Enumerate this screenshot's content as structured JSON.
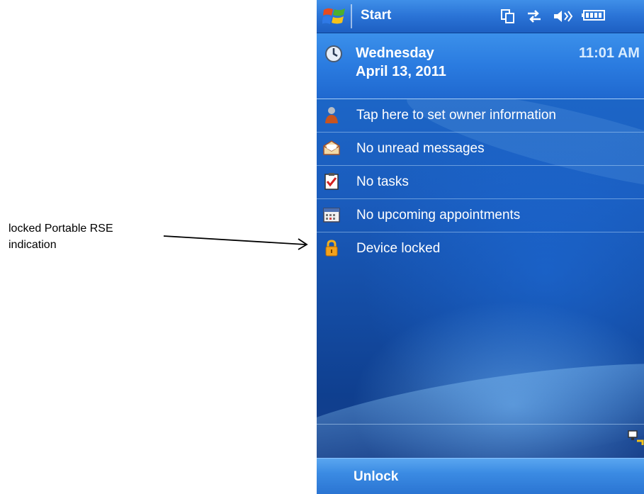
{
  "annotation": {
    "line1": "locked Portable RSE",
    "line2": "indication"
  },
  "topbar": {
    "start_label": "Start",
    "icons": [
      "windows-logo-icon",
      "multitask-icon",
      "connectivity-icon",
      "volume-icon",
      "battery-icon"
    ]
  },
  "today": {
    "day": "Wednesday",
    "date": "April 13, 2011",
    "time": "11:01 AM"
  },
  "items": [
    {
      "label": "Tap here to set owner information",
      "icon": "owner-icon"
    },
    {
      "label": "No unread messages",
      "icon": "messages-envelope-icon"
    },
    {
      "label": "No tasks",
      "icon": "tasks-clipboard-icon"
    },
    {
      "label": "No upcoming appointments",
      "icon": "calendar-icon"
    },
    {
      "label": "Device locked",
      "icon": "padlock-icon"
    }
  ],
  "softkeys": {
    "left": "Unlock"
  },
  "colors": {
    "background_top": "#1f6fd0",
    "background_bottom": "#0f3f8f",
    "bar": "#2a73d6",
    "text": "#ffffff"
  }
}
